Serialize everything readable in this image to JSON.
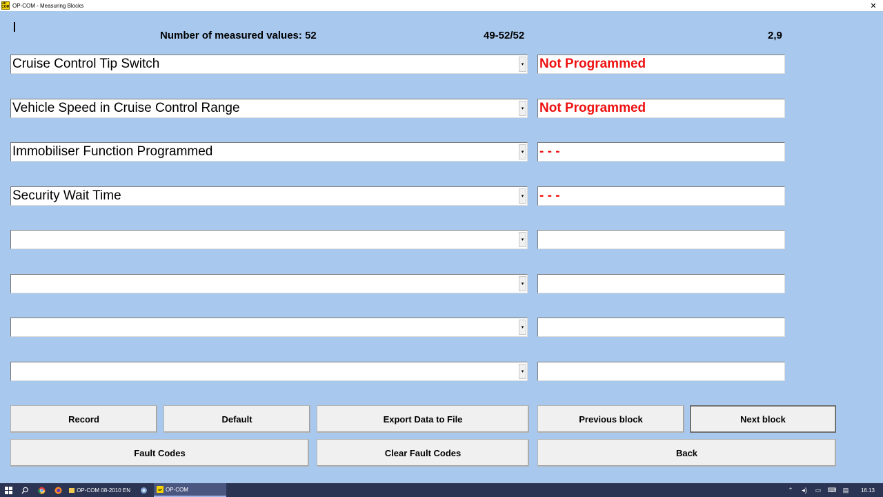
{
  "window": {
    "title": "OP-COM - Measuring Blocks",
    "app_icon_text": "OP COM",
    "close_glyph": "✕"
  },
  "header": {
    "measured_count": "Number of measured values: 52",
    "block_range": "49-52/52",
    "rate": "2,9"
  },
  "rows": [
    {
      "label": "Cruise Control Tip Switch",
      "value": "Not Programmed"
    },
    {
      "label": "Vehicle Speed in Cruise Control Range",
      "value": "Not Programmed"
    },
    {
      "label": "Immobiliser Function Programmed",
      "value": "- - -"
    },
    {
      "label": "Security Wait Time",
      "value": "- - -"
    },
    {
      "label": "",
      "value": ""
    },
    {
      "label": "",
      "value": ""
    },
    {
      "label": "",
      "value": ""
    },
    {
      "label": "",
      "value": ""
    }
  ],
  "buttons": {
    "record": "Record",
    "default": "Default",
    "export": "Export Data to File",
    "previous_block": "Previous block",
    "next_block": "Next block",
    "fault_codes": "Fault Codes",
    "clear_fault_codes": "Clear Fault Codes",
    "back": "Back"
  },
  "taskbar": {
    "folder_task": "OP-COM 08-2010 EN",
    "app_task": "OP-COM",
    "clock": "16.13"
  },
  "colors": {
    "background": "#a8c8ee",
    "value_text": "#ee1111",
    "taskbar": "#2b3452"
  },
  "icons": [
    "windows-start-icon",
    "search-icon",
    "chrome-icon",
    "firefox-icon",
    "network-tool-icon",
    "chevron-up-icon",
    "volume-icon",
    "battery-icon",
    "keyboard-icon",
    "notifications-icon"
  ]
}
